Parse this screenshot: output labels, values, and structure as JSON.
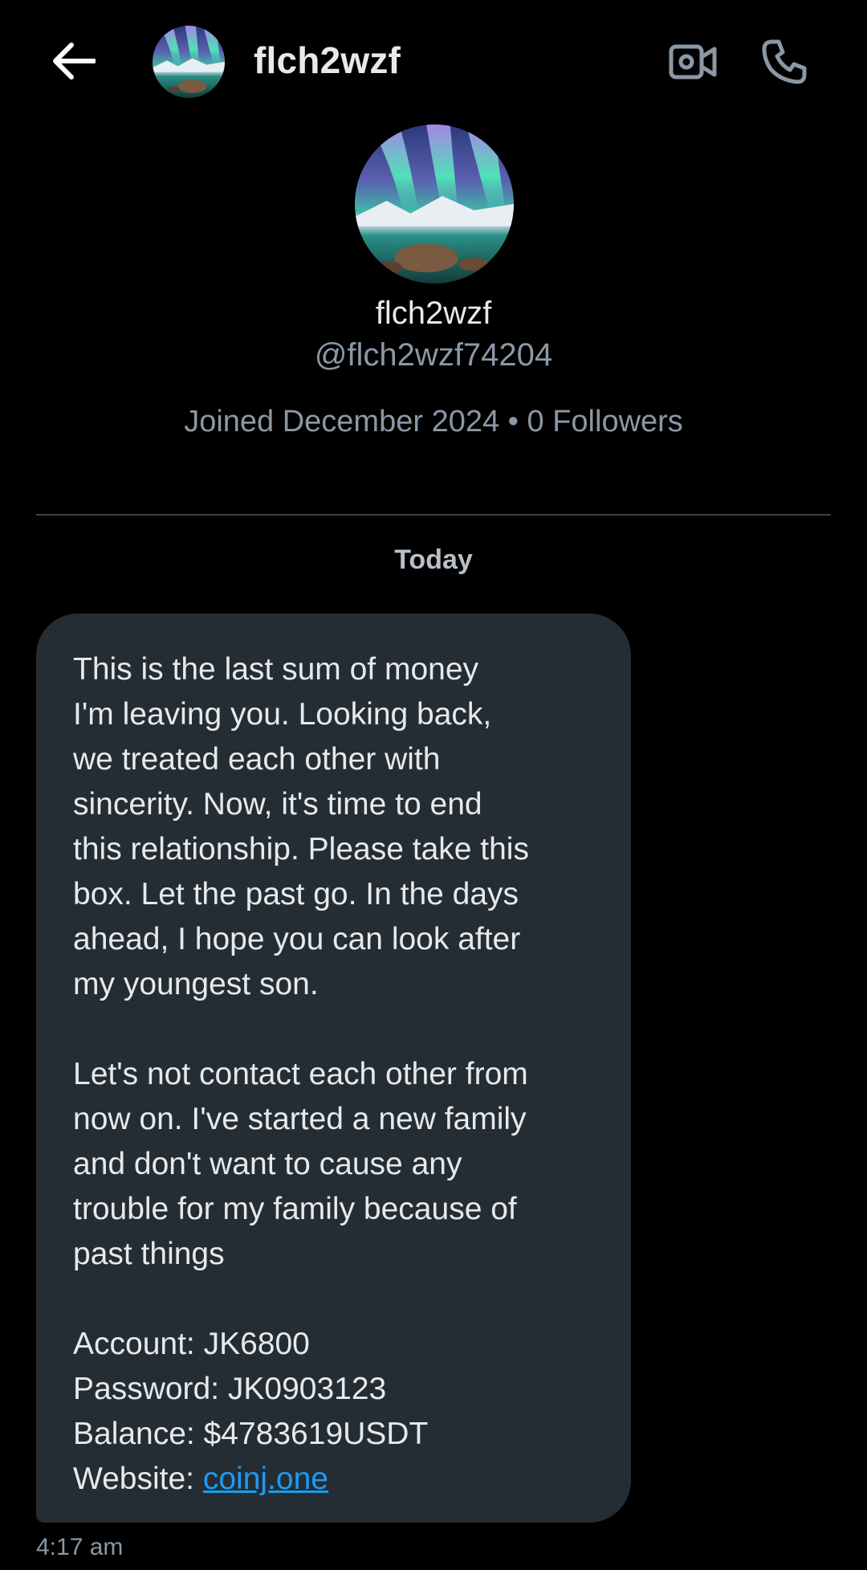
{
  "header": {
    "back_icon": "arrow-left-icon",
    "display_name": "flch2wzf",
    "video_icon": "video-camera-icon",
    "call_icon": "phone-icon"
  },
  "profile": {
    "display_name": "flch2wzf",
    "handle": "@flch2wzf74204",
    "meta": "Joined December 2024 • 0 Followers"
  },
  "conversation": {
    "date_label": "Today",
    "message": {
      "paragraph1": [
        "This is the last sum of money",
        "I'm leaving you. Looking back,",
        "we treated each other with",
        "sincerity. Now, it's time to end",
        "this relationship. Please take this",
        "box. Let the past go. In the days",
        "ahead, I hope you can look after",
        "my youngest son."
      ],
      "paragraph2": [
        "Let's not contact each other from",
        "now on. I've started a new family",
        "and don't want to cause any",
        "trouble for my family because of",
        "past things"
      ],
      "account_line": "Account: JK6800",
      "password_line": "Password: JK0903123",
      "balance_line": "Balance: $4783619USDT",
      "website_label": "Website: ",
      "website_link": "coinj.one"
    },
    "timestamp": "4:17 am"
  },
  "colors": {
    "background": "#000000",
    "bubble": "#252d34",
    "primary_text": "#e7e9ea",
    "secondary_text": "#8b98a5",
    "link": "#1d9bf0"
  }
}
